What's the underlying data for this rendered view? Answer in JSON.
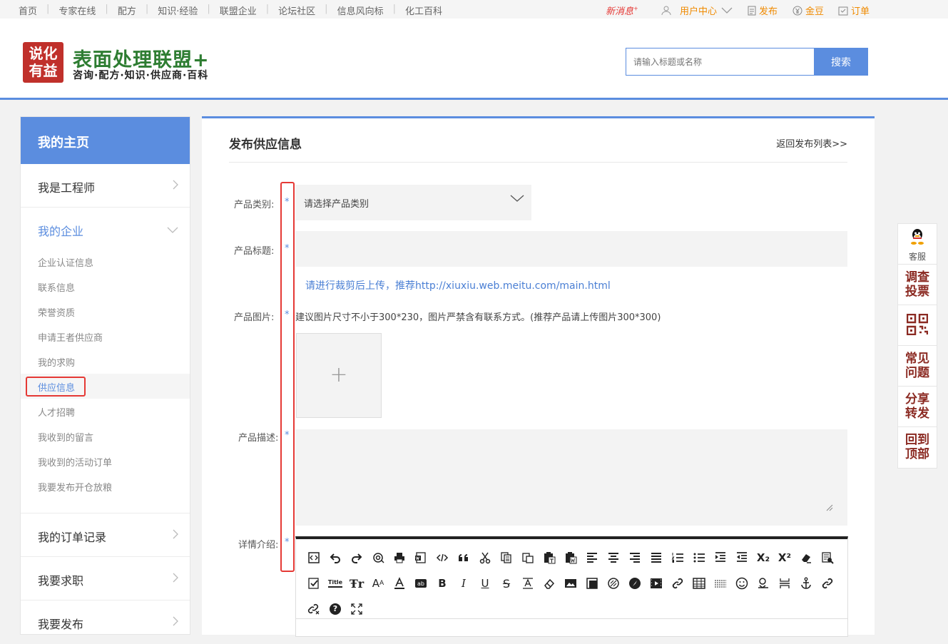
{
  "topnav": {
    "items": [
      "首页",
      "专家在线",
      "配方",
      "知识·经验",
      "联盟企业",
      "论坛社区",
      "信息风向标",
      "化工百科"
    ],
    "new_message": "新消息",
    "new_message_mark": "+",
    "user_center": "用户中心",
    "publish": "发布",
    "gold": "金豆",
    "order": "订单"
  },
  "header": {
    "logo_line1": "说化",
    "logo_line2": "有益",
    "title": "表面处理联盟+",
    "subtitle": "咨询·配方·知识·供应商·百科",
    "search_placeholder": "请输入标题或名称",
    "search_button": "搜索"
  },
  "sidebar": {
    "home": "我的主页",
    "engineer": "我是工程师",
    "enterprise": "我的企业",
    "sub_items": [
      "企业认证信息",
      "联系信息",
      "荣誉资质",
      "申请王者供应商",
      "我的求购",
      "供应信息",
      "人才招聘",
      "我收到的留言",
      "我收到的活动订单",
      "我要发布开仓放粮"
    ],
    "orders": "我的订单记录",
    "job": "我要求职",
    "publish": "我要发布"
  },
  "main": {
    "title": "发布供应信息",
    "return_link": "返回发布列表>>",
    "required_mark": "*",
    "category_label": "产品类别:",
    "category_placeholder": "请选择产品类别",
    "title_label": "产品标题:",
    "crop_hint": "请进行裁剪后上传，推荐http://xiuxiu.web.meitu.com/main.html",
    "image_label": "产品图片:",
    "image_hint": "建议图片尺寸不小于300*230，图片严禁含有联系方式。(推荐产品请上传图片300*300)",
    "upload_plus": "+",
    "desc_label": "产品描述:",
    "detail_label": "详情介绍:"
  },
  "editor": {
    "toolbar_icons": [
      "source-icon",
      "undo-icon",
      "redo-icon",
      "anchor-at-icon",
      "print-icon",
      "word-icon",
      "code-icon",
      "quote-icon",
      "cut-icon",
      "copy-icon",
      "paste-icon",
      "paste-text-icon",
      "paste-word-icon",
      "align-left-icon",
      "align-center-icon",
      "align-right-icon",
      "justify-icon",
      "ordered-list-icon",
      "unordered-list-icon",
      "indent-icon",
      "outdent-icon",
      "subscript-icon",
      "superscript-icon",
      "clear-format-icon",
      "select-all-icon",
      "spellcheck-icon",
      "title-icon",
      "font-family-icon",
      "font-size-icon",
      "font-color-icon",
      "bg-color-icon",
      "bold-icon",
      "italic-icon",
      "underline-icon",
      "strikethrough-icon",
      "line-height-icon",
      "eraser-icon",
      "image-icon",
      "multi-image-icon",
      "flash-icon",
      "media-icon",
      "video-icon",
      "link-icon",
      "table-icon",
      "hr-icon",
      "emoticon-icon",
      "map-icon",
      "page-break-icon",
      "anchor-icon",
      "link2-icon",
      "unlink-icon",
      "help-icon",
      "fullscreen-icon"
    ],
    "subscript_text": "X₂",
    "superscript_text": "X²",
    "bold_text": "B",
    "italic_text": "I",
    "underline_text": "U",
    "strike_text": "S",
    "title_text": "Title",
    "help_text": "?"
  },
  "float_bar": {
    "service": "客服",
    "survey": "调查投票",
    "faq": "常见问题",
    "share": "分享转发",
    "top": "回到顶部"
  },
  "colors": {
    "accent": "#5b8ddf",
    "brand_red": "#c0302b",
    "brand_green": "#2e7d32",
    "warn_orange": "#f08a00",
    "highlight_red": "#e53935",
    "float_text": "#8b2a22"
  }
}
